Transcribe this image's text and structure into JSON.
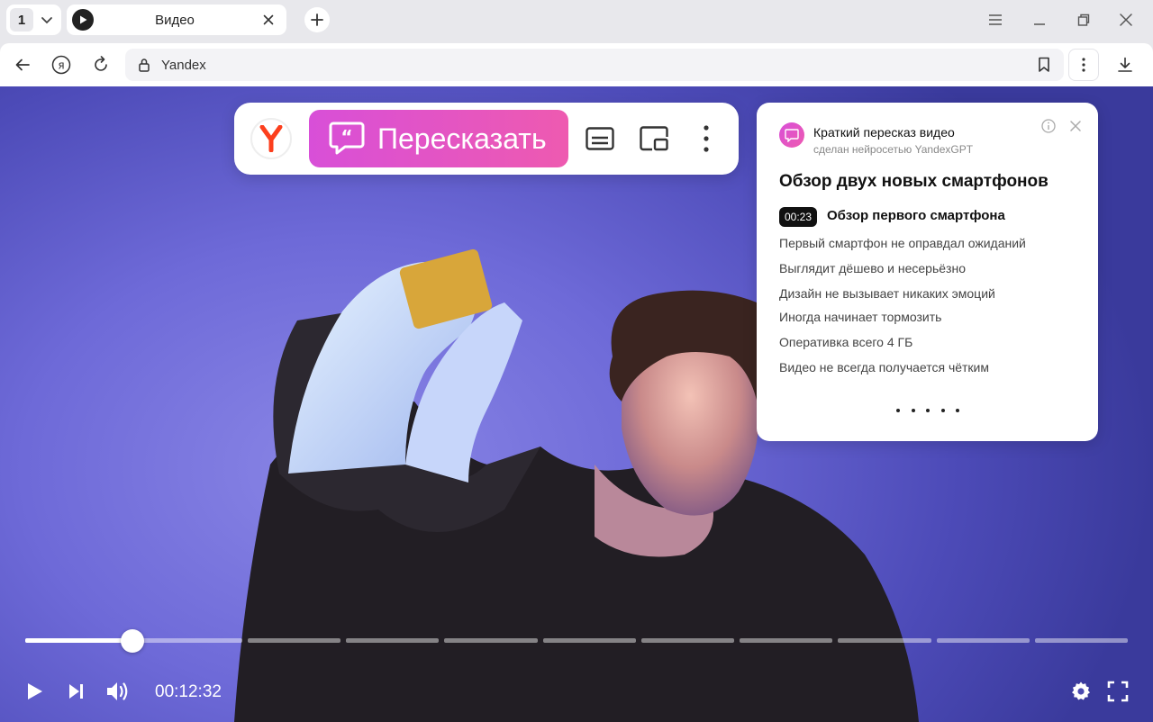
{
  "tabs": {
    "counter": "1",
    "active_title": "Видео"
  },
  "toolbar": {
    "url": "Yandex"
  },
  "floatbar": {
    "retell_label": "Пересказать"
  },
  "summary": {
    "header_title": "Краткий пересказ видео",
    "header_subtitle": "сделан нейросетью YandexGPT",
    "heading": "Обзор двух новых смартфонов",
    "chapter": {
      "timestamp": "00:23",
      "title": "Обзор первого смартфона"
    },
    "points": [
      "Первый смартфон не оправдал ожиданий",
      "Выглядит дёшево и несерьёзно",
      "Дизайн не вызывает никаких эмоций",
      "Иногда начинает тормозить",
      "Оперативка всего 4 ГБ",
      "Видео не всегда получается чётким"
    ]
  },
  "player": {
    "current_time": "00:12:32",
    "progress_fraction": 0.097,
    "segment_count": 10
  },
  "colors": {
    "accent_gradient_start": "#d84fd8",
    "accent_gradient_end": "#ee5ab0",
    "yandex_red": "#fc3f1d"
  }
}
